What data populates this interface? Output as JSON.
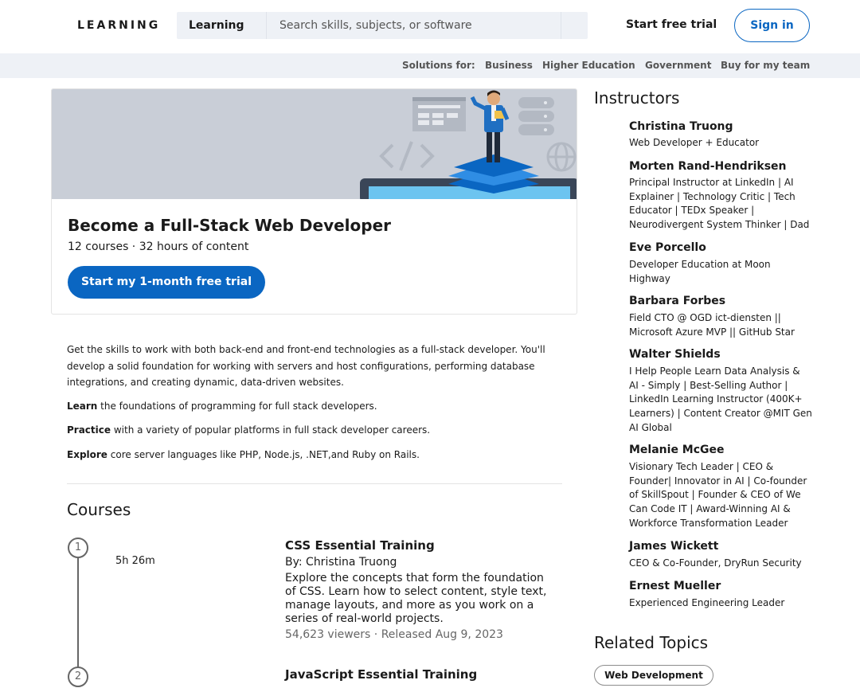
{
  "header": {
    "logo": "LEARNING",
    "search_category": "Learning",
    "search_placeholder": "Search skills, subjects, or software",
    "trial_link": "Start free trial",
    "signin": "Sign in"
  },
  "solutions_bar": {
    "label": "Solutions for:",
    "items": [
      "Business",
      "Higher Education",
      "Government",
      "Buy for my team"
    ]
  },
  "path_card": {
    "title": "Become a Full-Stack Web Developer",
    "meta": "12 courses  ·  32 hours of content",
    "cta": "Start my 1-month free trial",
    "hero_icons": [
      "code-icon",
      "globe-icon",
      "server-stack-icon"
    ]
  },
  "description": {
    "intro": "Get the skills to work with both back-end and front-end technologies as a full-stack developer. You'll develop a solid foundation for working with servers and host configurations, performing database integrations, and creating dynamic, data-driven websites.",
    "bullets": [
      {
        "lead": "Learn",
        "rest": " the foundations of programming for full stack developers."
      },
      {
        "lead": "Practice",
        "rest": " with a variety of popular platforms in full stack developer careers."
      },
      {
        "lead": "Explore",
        "rest": " core server languages like PHP, Node.js, .NET,and Ruby on Rails."
      }
    ]
  },
  "courses": {
    "heading": "Courses",
    "items": [
      {
        "step": "1",
        "duration": "5h 26m",
        "title": "CSS Essential Training",
        "by": "By: Christina Truong",
        "description": "Explore the concepts that form the foundation of CSS. Learn how to select content, style text, manage layouts, and more as you work on a series of real-world projects.",
        "stats": "54,623 viewers   · Released Aug 9, 2023"
      },
      {
        "step": "2",
        "duration": "",
        "title": "JavaScript Essential Training",
        "by": "",
        "description": "",
        "stats": ""
      }
    ]
  },
  "instructors": {
    "heading": "Instructors",
    "items": [
      {
        "name": "Christina Truong",
        "bio": "Web Developer + Educator"
      },
      {
        "name": "Morten Rand-Hendriksen",
        "bio": "Principal Instructor at LinkedIn | AI Explainer | Technology Critic | Tech Educator | TEDx Speaker | Neurodivergent System Thinker | Dad"
      },
      {
        "name": "Eve Porcello",
        "bio": "Developer Education at Moon Highway"
      },
      {
        "name": "Barbara Forbes",
        "bio": "Field CTO @ OGD ict-diensten || Microsoft Azure MVP || GitHub Star"
      },
      {
        "name": "Walter Shields",
        "bio": "I Help People Learn Data Analysis & AI - Simply | Best-Selling Author | LinkedIn Learning Instructor (400K+ Learners) | Content Creator @MIT Gen AI Global"
      },
      {
        "name": "Melanie McGee",
        "bio": "Visionary Tech Leader | CEO & Founder| Innovator in AI | Co-founder of SkillSpout | Founder & CEO of We Can Code IT | Award-Winning AI & Workforce Transformation Leader"
      },
      {
        "name": "James Wickett",
        "bio": "CEO & Co-Founder, DryRun Security"
      },
      {
        "name": "Ernest Mueller",
        "bio": "Experienced Engineering Leader"
      }
    ]
  },
  "related": {
    "heading": "Related Topics",
    "topics": [
      "Web Development"
    ]
  }
}
